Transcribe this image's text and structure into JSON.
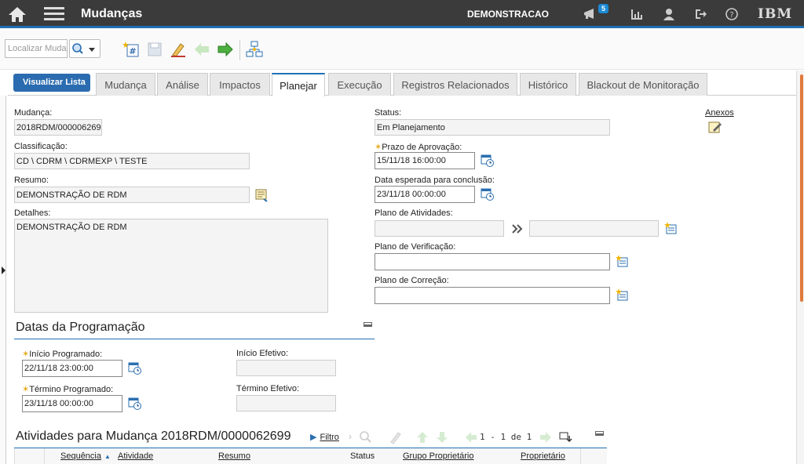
{
  "header": {
    "title": "Mudanças",
    "user": "DEMONSTRACAO",
    "messages_count": "5",
    "brand": "IBM"
  },
  "toolbar": {
    "find_placeholder": "Localizar Muda"
  },
  "tabs": {
    "list_button": "Visualizar Lista",
    "items": [
      "Mudança",
      "Análise",
      "Impactos",
      "Planejar",
      "Execução",
      "Registros Relacionados",
      "Histórico",
      "Blackout de Monitoração"
    ],
    "active": "Planejar"
  },
  "form": {
    "change_label": "Mudança:",
    "change_value": "2018RDM/0000062699",
    "class_label": "Classificação:",
    "class_value": "CD \\ CDRM \\ CDRMEXP \\ TESTE",
    "summary_label": "Resumo:",
    "summary_value": "DEMONSTRAÇÃO DE RDM",
    "details_label": "Detalhes:",
    "details_value": "DEMONSTRAÇÃO DE RDM",
    "status_label": "Status:",
    "status_value": "Em Planejamento",
    "approval_label": "Prazo de Aprovação:",
    "approval_value": "15/11/18 16:00:00",
    "expected_label": "Data esperada para conclusão:",
    "expected_value": "23/11/18 00:00:00",
    "activity_plan_label": "Plano de Atividades:",
    "verification_label": "Plano de Verificação:",
    "correction_label": "Plano de Correção:",
    "attachments_label": "Anexos"
  },
  "schedule": {
    "title": "Datas da Programação",
    "start_label": "Início Programado:",
    "start_value": "22/11/18 23:00:00",
    "end_label": "Término Programado:",
    "end_value": "23/11/18 00:00:00",
    "actual_start_label": "Início Efetivo:",
    "actual_end_label": "Término Efetivo:"
  },
  "activities": {
    "title": "Atividades para Mudança 2018RDM/0000062699",
    "filter": "Filtro",
    "pager": "1 - 1 de 1",
    "columns": [
      "Sequência",
      "Atividade",
      "Resumo",
      "Status",
      "Grupo Proprietário",
      "Proprietário"
    ]
  },
  "colors": {
    "accent": "#1f6fb3",
    "topbar": "#3b3b3b",
    "required": "#e6a817",
    "scroll": "#e07a3a"
  }
}
